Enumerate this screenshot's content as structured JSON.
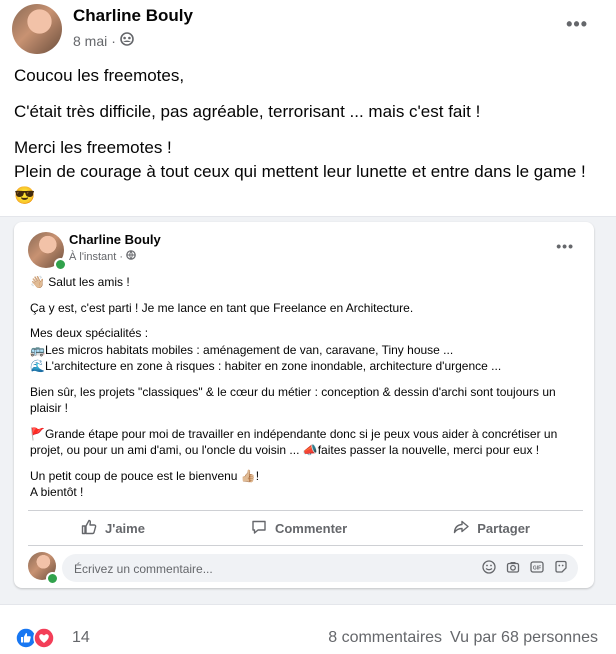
{
  "post": {
    "author": "Charline Bouly",
    "date": "8 mai",
    "date_separator": "·",
    "greeting": "Coucou les freemotes,",
    "line2": "C'était très difficile, pas agréable, terrorisant ... mais c'est fait !",
    "line3": "Merci les freemotes !",
    "line4": "Plein de courage à tout ceux qui mettent leur lunette et entre dans le game !",
    "line4_emoji": "😎"
  },
  "shared": {
    "author": "Charline Bouly",
    "time": "À l'instant",
    "time_separator": "·",
    "p1_emoji": "👋🏼",
    "p1": "Salut les amis !",
    "p2": "Ça y est, c'est parti ! Je me lance en tant que Freelance en Architecture.",
    "p3_title": "Mes deux spécialités :",
    "p3_l1_emoji": "🚌",
    "p3_l1": "Les micros habitats mobiles : aménagement de van, caravane, Tiny house ...",
    "p3_l2_emoji": "🌊",
    "p3_l2": "L'architecture en zone à risques : habiter en zone inondable, architecture d'urgence ...",
    "p4": "Bien sûr, les projets \"classiques\" & le cœur du métier : conception & dessin d'archi sont toujours un plaisir !",
    "p5_emoji": "🚩",
    "p5a": "Grande étape pour moi de travailler en indépendante donc si je peux vous aider à concrétiser un projet, ou pour un ami d'ami, ou l'oncle du voisin ... ",
    "p5_emoji2": "📣",
    "p5b": "faites passer la nouvelle, merci pour eux !",
    "p6": "Un petit coup de pouce est le bienvenu ",
    "p6_emoji": "👍🏼",
    "p6_end": "!",
    "p7": "A bientôt !",
    "actions": {
      "like": "J'aime",
      "comment": "Commenter",
      "share": "Partager"
    },
    "comment_placeholder": "Écrivez un commentaire..."
  },
  "footer": {
    "reaction_count": "14",
    "comments": "8 commentaires",
    "views": "Vu par 68 personnes"
  },
  "colors": {
    "like_blue": "#1877f2",
    "love_red": "#f33e58",
    "online_green": "#31a24c",
    "muted": "#65676b"
  }
}
